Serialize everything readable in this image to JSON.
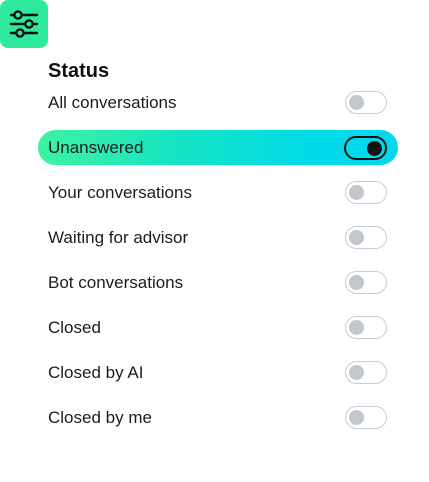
{
  "filter_button": {
    "icon": "sliders-icon",
    "color": "#2ee89c"
  },
  "status": {
    "title": "Status",
    "items": [
      {
        "label": "All conversations",
        "on": false
      },
      {
        "label": "Unanswered",
        "on": true
      },
      {
        "label": "Your conversations",
        "on": false
      },
      {
        "label": "Waiting for advisor",
        "on": false
      },
      {
        "label": "Bot conversations",
        "on": false
      },
      {
        "label": "Closed",
        "on": false
      },
      {
        "label": "Closed by AI",
        "on": false
      },
      {
        "label": "Closed by me",
        "on": false
      }
    ]
  },
  "colors": {
    "accent_start": "#3ef2a0",
    "accent_end": "#00d9ec",
    "toggle_off": "#c2c7ce",
    "toggle_on": "#111111"
  }
}
